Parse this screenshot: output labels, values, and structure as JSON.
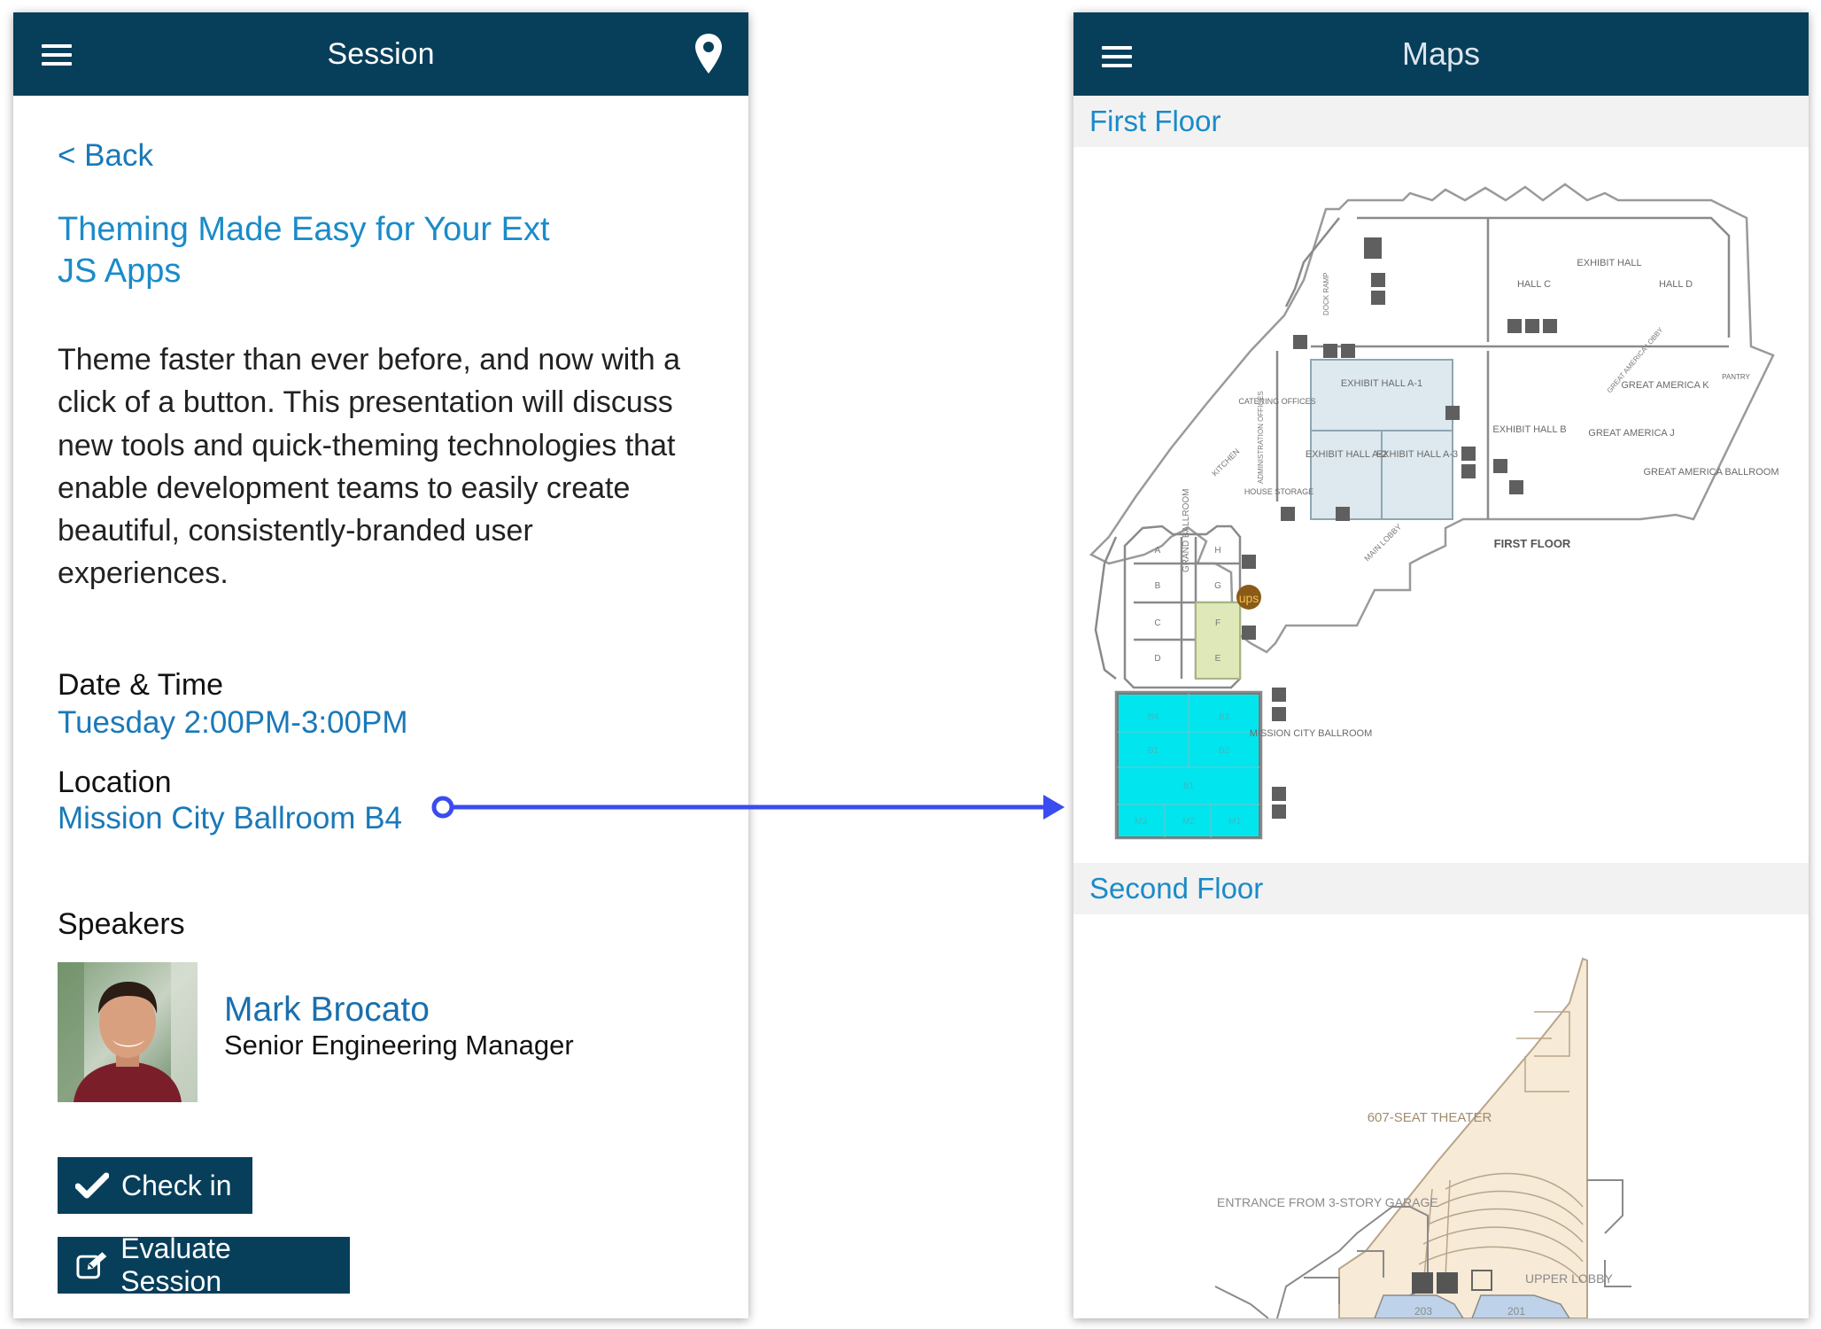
{
  "session_screen": {
    "header_title": "Session",
    "back_label": "< Back",
    "title": "Theming Made Easy for Your Ext JS Apps",
    "description": "Theme faster than ever before, and now with a click of a button. This presentation will discuss new tools and quick-theming technologies that enable development teams to easily create beautiful, consistently-branded user experiences.",
    "datetime_label": "Date & Time",
    "datetime_value": "Tuesday 2:00PM-3:00PM",
    "location_label": "Location",
    "location_value": "Mission City Ballroom B4",
    "speakers_label": "Speakers",
    "speaker": {
      "name": "Mark Brocato",
      "role": "Senior Engineering Manager"
    },
    "checkin_label": "Check in",
    "evaluate_label": "Evaluate Session"
  },
  "maps_screen": {
    "header_title": "Maps",
    "first_floor_label": "First Floor",
    "second_floor_label": "Second Floor",
    "first_floor_map": {
      "exhibit_hall": "EXHIBIT HALL",
      "hall_c": "HALL C",
      "hall_d": "HALL D",
      "exhibit_hall_a1": "EXHIBIT HALL A-1",
      "exhibit_hall_a2": "EXHIBIT HALL A-2",
      "exhibit_hall_a3": "EXHIBIT HALL A-3",
      "exhibit_hall_b": "EXHIBIT HALL B",
      "great_america_k": "GREAT AMERICA K",
      "great_america_j": "GREAT AMERICA J",
      "great_america_ballroom": "GREAT AMERICA BALLROOM",
      "first_floor": "FIRST FLOOR",
      "grand_ballroom": "GRAND BALLROOM",
      "mission_city_ballroom": "MISSION CITY BALLROOM",
      "catering_offices": "CATERING OFFICES",
      "administration_offices": "ADMINISTRATION OFFICES",
      "house_storage": "HOUSE STORAGE",
      "kitchen": "KITCHEN",
      "main_lobby": "MAIN LOBBY",
      "dock_ramp": "DOCK RAMP",
      "great_america_lobby": "GREAT AMERICA LOBBY",
      "pantry": "PANTRY",
      "ups": "ups",
      "grand_rooms": [
        "A",
        "B",
        "C",
        "D",
        "E",
        "F",
        "G",
        "H"
      ],
      "mission_rooms": [
        "B4",
        "B3",
        "B1",
        "B2",
        "B1",
        "M3",
        "M2",
        "M1"
      ]
    },
    "second_floor_map": {
      "theater": "607-SEAT THEATER",
      "entrance": "ENTRANCE FROM 3-STORY GARAGE",
      "upper_lobby": "UPPER LOBBY",
      "room_203": "203",
      "room_201": "201"
    }
  },
  "colors": {
    "header": "#073f5b",
    "link": "#1a79b8",
    "connector": "#3a4cf0",
    "highlight_room": "#00e5ee",
    "exhibit_room": "#dde9ef",
    "grand_room": "#dfe8b8",
    "theater": "#f7ead6",
    "second_floor_blue": "#bed3ea"
  },
  "icons": [
    "hamburger-icon",
    "map-pin-icon",
    "checkmark-icon",
    "edit-icon"
  ]
}
